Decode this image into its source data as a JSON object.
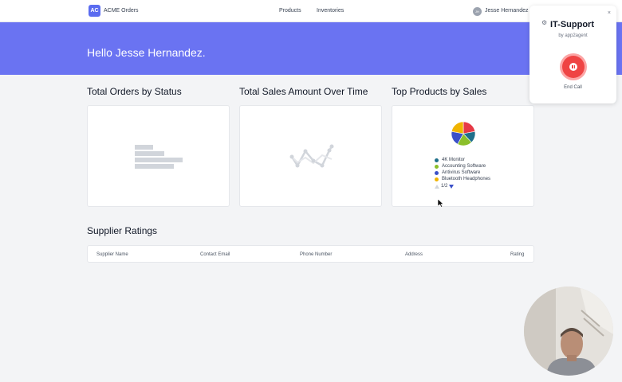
{
  "header": {
    "logo_text": "AC",
    "brand": "ACME Orders",
    "nav": [
      "Products",
      "Inventories"
    ],
    "user_initials": "JH",
    "user_name": "Jesse Hernandez"
  },
  "hero": {
    "greeting": "Hello Jesse Hernandez."
  },
  "sections": {
    "orders_by_status": "Total Orders by Status",
    "sales_over_time": "Total Sales Amount Over Time",
    "top_products": "Top Products by Sales",
    "supplier_ratings": "Supplier Ratings"
  },
  "top_products": {
    "legend": [
      {
        "label": "4K Monitor",
        "color": "#1f6f8b"
      },
      {
        "label": "Accounting Software",
        "color": "#8bbf2a"
      },
      {
        "label": "Antivirus Software",
        "color": "#3b50c8"
      },
      {
        "label": "Bluetooth Headphones",
        "color": "#f0b400"
      }
    ],
    "pager": "1/2",
    "pie_colors": [
      "#e63946",
      "#1f6f8b",
      "#8bbf2a",
      "#3b50c8",
      "#f0b400"
    ]
  },
  "table": {
    "columns": [
      "Supplier Name",
      "Contact Email",
      "Phone Number",
      "Address",
      "Rating"
    ]
  },
  "support": {
    "title": "IT-Support",
    "subtitle": "by app2agent",
    "end_call": "End Call",
    "close": "×"
  }
}
